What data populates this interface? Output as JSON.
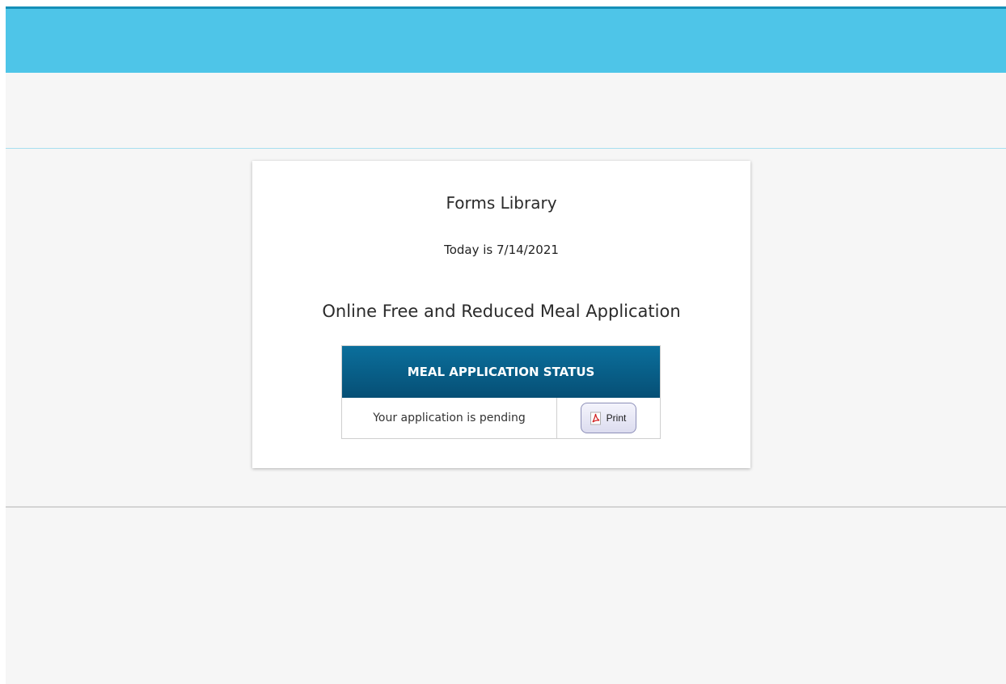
{
  "card": {
    "title": "Forms Library",
    "date_text": "Today is 7/14/2021",
    "subtitle": "Online Free and Reduced Meal Application"
  },
  "status_table": {
    "header": "MEAL APPLICATION STATUS",
    "status_text": "Your application is pending",
    "print_label": "Print",
    "print_icon": "pdf-icon"
  },
  "colors": {
    "header_bar": "#4ec5e8",
    "top_border": "#1590b8",
    "table_header": "#0b6f9c",
    "page_background": "#f6f6f6"
  }
}
